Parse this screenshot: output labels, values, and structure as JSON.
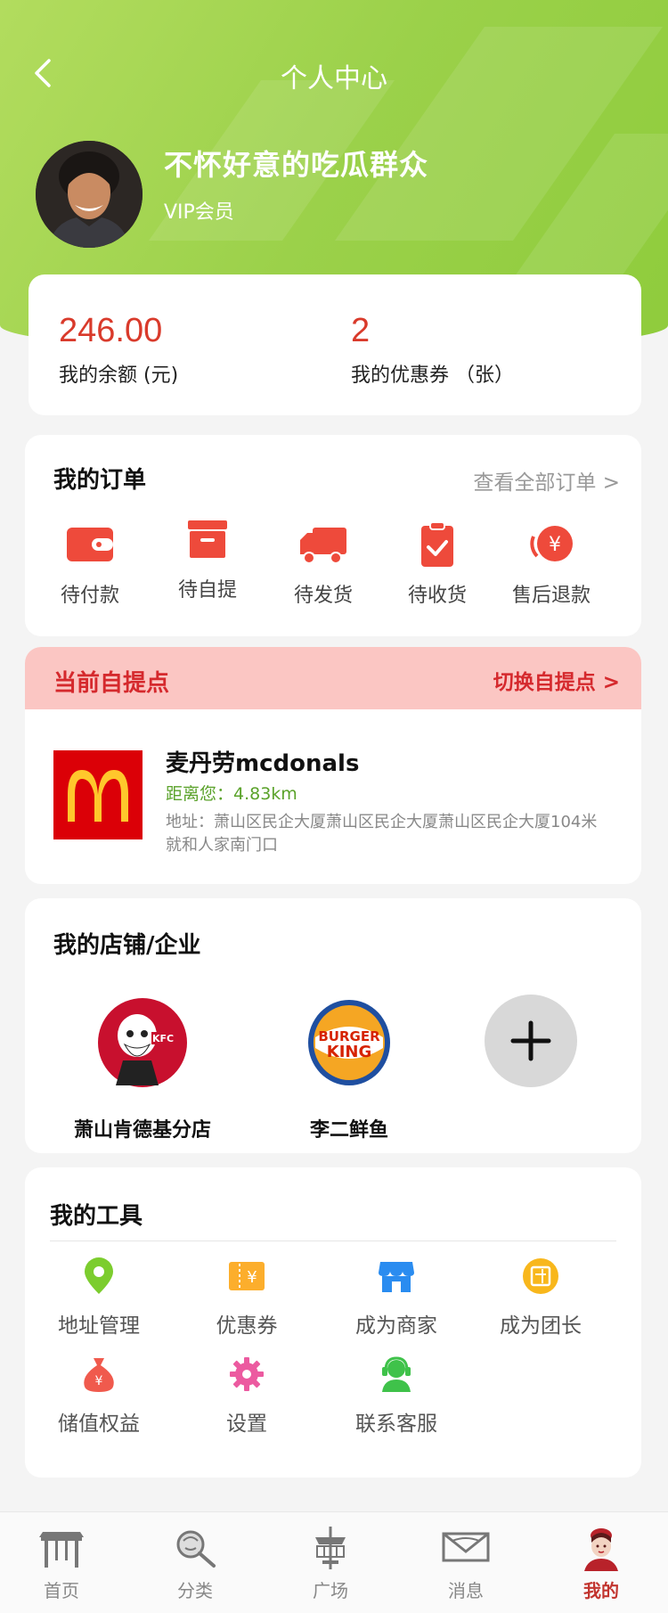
{
  "header": {
    "title": "个人中心"
  },
  "user": {
    "name": "不怀好意的吃瓜群众",
    "level": "VIP会员"
  },
  "balance": {
    "amount": "246.00",
    "amount_label": "我的余额 (元)",
    "coupons": "2",
    "coupons_label": "我的优惠券 （张）"
  },
  "orders": {
    "title": "我的订单",
    "view_all": "查看全部订单 >",
    "items": [
      {
        "label": "待付款",
        "icon": "wallet-icon"
      },
      {
        "label": "待自提",
        "icon": "box-icon"
      },
      {
        "label": "待发货",
        "icon": "truck-icon"
      },
      {
        "label": "待收货",
        "icon": "clipboard-check-icon"
      },
      {
        "label": "售后退款",
        "icon": "refund-icon"
      }
    ]
  },
  "pickup": {
    "title": "当前自提点",
    "switch": "切换自提点 >",
    "store_name": "麦丹劳mcdonals",
    "distance": "距离您：4.83km",
    "address": "地址：萧山区民企大厦萧山区民企大厦萧山区民企大厦104米就和人家南门口"
  },
  "shops": {
    "title": "我的店铺/企业",
    "items": [
      {
        "label": "萧山肯德基分店",
        "icon": "kfc-logo"
      },
      {
        "label": "李二鲜鱼",
        "icon": "burger-king-logo"
      }
    ]
  },
  "tools": {
    "title": "我的工具",
    "items": [
      {
        "label": "地址管理",
        "icon": "location-pin-icon"
      },
      {
        "label": "优惠券",
        "icon": "coupon-icon"
      },
      {
        "label": "成为商家",
        "icon": "store-icon"
      },
      {
        "label": "成为团长",
        "icon": "group-leader-icon"
      },
      {
        "label": "储值权益",
        "icon": "money-bag-icon"
      },
      {
        "label": "设置",
        "icon": "gear-icon"
      },
      {
        "label": "联系客服",
        "icon": "customer-service-icon"
      }
    ]
  },
  "tabbar": {
    "items": [
      {
        "label": "首页",
        "icon": "home-icon"
      },
      {
        "label": "分类",
        "icon": "category-icon"
      },
      {
        "label": "广场",
        "icon": "plaza-icon"
      },
      {
        "label": "消息",
        "icon": "message-icon"
      },
      {
        "label": "我的",
        "icon": "profile-icon"
      }
    ],
    "active_index": 4
  },
  "colors": {
    "brand_green": "#9bd14a",
    "accent_red": "#d93a2b",
    "pickup_bg": "#fbc6c3"
  }
}
